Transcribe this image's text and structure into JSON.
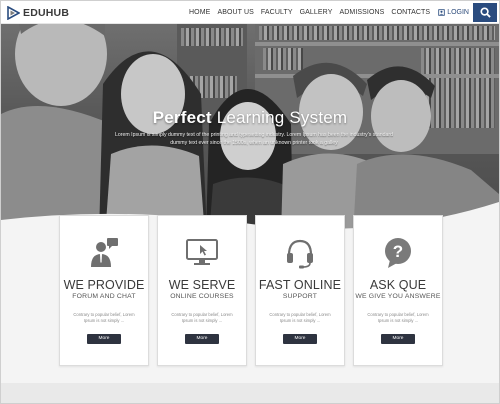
{
  "header": {
    "logo_text": "EDUHUB",
    "nav": [
      "HOME",
      "ABOUT US",
      "FACULTY",
      "GALLERY",
      "ADMISSIONS",
      "CONTACTS"
    ],
    "login_label": "LOGIN",
    "search_icon": "search-icon",
    "accent_color": "#2a4c7f"
  },
  "hero": {
    "title_bold": "Perfect",
    "title_rest": " Learning System",
    "subtitle": "Lorem Ipsum is simply dummy text of the printing and typesetting industry. Lorem Ipsum has been the industry's standard dummy text ever since the 1500s, when an unknown printer took a galley"
  },
  "cards": [
    {
      "icon": "support-person-icon",
      "title": "WE PROVIDE",
      "subtitle": "FORUM AND CHAT",
      "text": "Contrary to popular belief, Lorem Ipsum is not simply ...",
      "button": "More"
    },
    {
      "icon": "monitor-icon",
      "title": "WE SERVE",
      "subtitle": "ONLINE COURSES",
      "text": "Contrary to popular belief, Lorem Ipsum is not simply ...",
      "button": "More"
    },
    {
      "icon": "headset-icon",
      "title": "FAST ONLINE",
      "subtitle": "SUPPORT",
      "text": "Contrary to popular belief, Lorem Ipsum is not simply ...",
      "button": "More"
    },
    {
      "icon": "question-bubble-icon",
      "title": "ASK QUE",
      "subtitle": "WE GIVE YOU ANSWERE",
      "text": "Contrary to popular belief, Lorem Ipsum is not simply ...",
      "button": "More"
    }
  ]
}
